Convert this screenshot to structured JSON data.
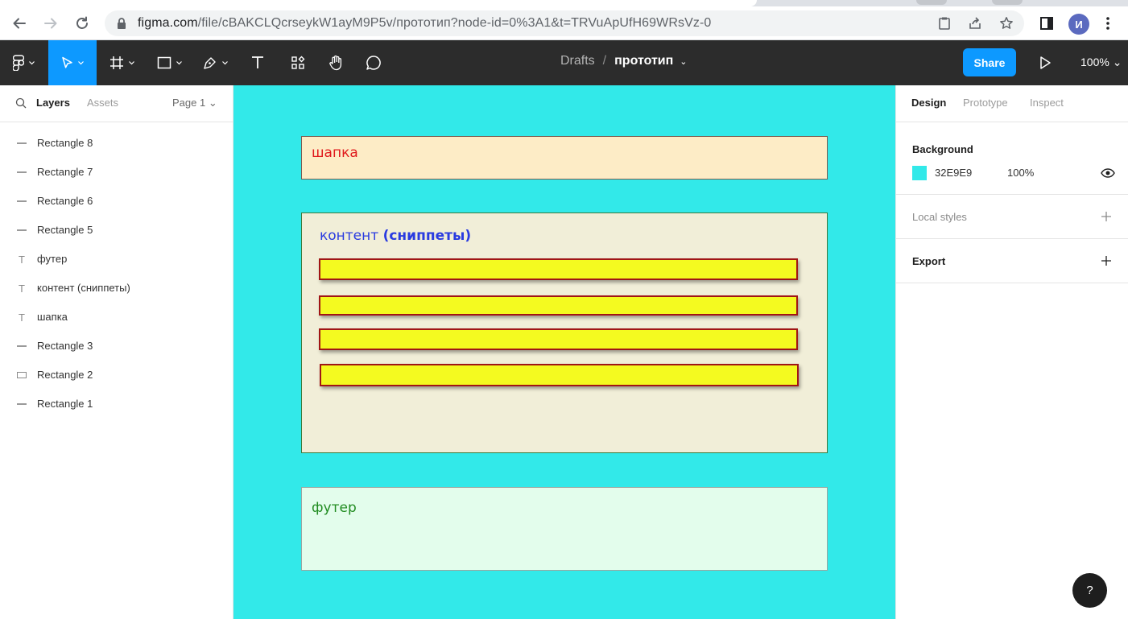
{
  "browser": {
    "url_host": "figma.com",
    "url_path": "/file/cBAKCLQcrseykW1ayM9P5v/прототип?node-id=0%3A1&t=TRVuApUfH69WRsVz-0",
    "profile_initial": "И"
  },
  "toolbar": {
    "breadcrumb_parent": "Drafts",
    "breadcrumb_separator": "/",
    "file_name": "прототип",
    "share_label": "Share",
    "zoom_label": "100%",
    "tools": [
      "main-menu",
      "move",
      "frame",
      "shape",
      "pen",
      "text",
      "resources",
      "hand",
      "comment"
    ]
  },
  "left_panel": {
    "tab_layers": "Layers",
    "tab_assets": "Assets",
    "page_label": "Page 1",
    "layers": [
      {
        "name": "Rectangle 8",
        "icon": "line-icon"
      },
      {
        "name": "Rectangle 7",
        "icon": "line-icon"
      },
      {
        "name": "Rectangle 6",
        "icon": "line-icon"
      },
      {
        "name": "Rectangle 5",
        "icon": "line-icon"
      },
      {
        "name": "футер",
        "icon": "text-icon"
      },
      {
        "name": "контент (сниппеты)",
        "icon": "text-icon"
      },
      {
        "name": "шапка",
        "icon": "text-icon"
      },
      {
        "name": "Rectangle 3",
        "icon": "line-icon"
      },
      {
        "name": "Rectangle 2",
        "icon": "rectangle-icon"
      },
      {
        "name": "Rectangle 1",
        "icon": "line-icon"
      }
    ]
  },
  "canvas": {
    "background_color": "#32e9e9",
    "header_text": "шапка",
    "content_text_normal": "контент ",
    "content_text_bold": "(сниппеты)",
    "footer_text": "футер",
    "snippet_count": 4
  },
  "right_panel": {
    "tab_design": "Design",
    "tab_prototype": "Prototype",
    "tab_inspect": "Inspect",
    "background_title": "Background",
    "background_hex": "32E9E9",
    "background_opacity": "100%",
    "local_styles_title": "Local styles",
    "export_title": "Export"
  },
  "help_label": "?"
}
